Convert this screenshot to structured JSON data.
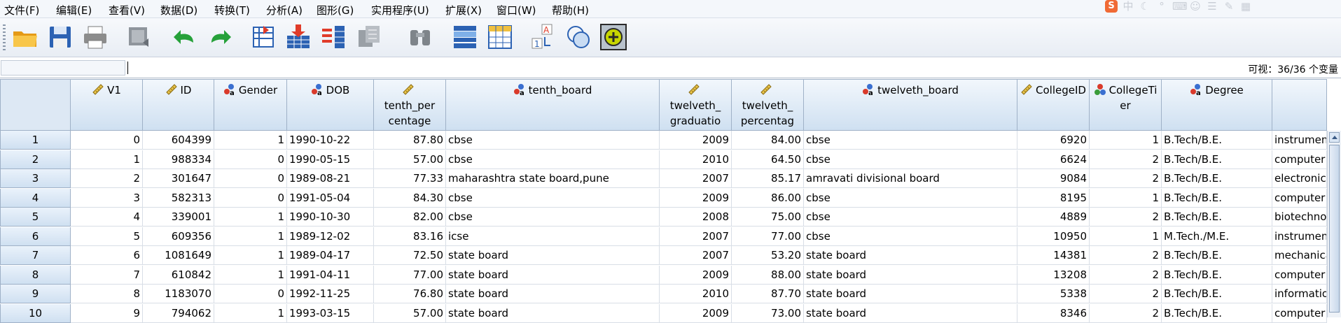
{
  "menu": [
    "文件(F)",
    "编辑(E)",
    "查看(V)",
    "数据(D)",
    "转换(T)",
    "分析(A)",
    "图形(G)",
    "实用程序(U)",
    "扩展(X)",
    "窗口(W)",
    "帮助(H)"
  ],
  "tray_icons": [
    "sogou-s-icon",
    "chinese-input-icon",
    "moon-icon",
    "punctuation-icon",
    "keyboard-icon",
    "user-icon",
    "menu-icon",
    "skin-icon",
    "grid-icon"
  ],
  "toolbar": [
    {
      "name": "open-folder-icon"
    },
    {
      "name": "save-icon"
    },
    {
      "name": "print-icon"
    },
    {
      "name": "dialog-recall-icon"
    },
    {
      "name": "undo-icon"
    },
    {
      "name": "redo-icon"
    },
    {
      "name": "goto-case-icon"
    },
    {
      "name": "goto-variable-icon"
    },
    {
      "name": "variables-icon"
    },
    {
      "name": "run-descriptives-icon"
    },
    {
      "name": "find-icon"
    },
    {
      "name": "insert-cases-icon"
    },
    {
      "name": "insert-variable-icon"
    },
    {
      "name": "split-file-icon"
    },
    {
      "name": "weight-cases-icon"
    },
    {
      "name": "select-cases-icon"
    },
    {
      "name": "value-labels-icon"
    },
    {
      "name": "use-variable-sets-icon"
    }
  ],
  "editbar": {
    "cell_name": "",
    "cell_value": "",
    "visible_count": "可视：36/36 个变量"
  },
  "columns": [
    {
      "name": "V1",
      "type": "scale",
      "align": "right"
    },
    {
      "name": "ID",
      "type": "scale",
      "align": "right"
    },
    {
      "name": "Gender",
      "type": "nominal",
      "align": "right"
    },
    {
      "name": "DOB",
      "type": "nominal",
      "align": "left"
    },
    {
      "name": "tenth_per\ncentage",
      "type": "scale",
      "align": "right"
    },
    {
      "name": "tenth_board",
      "type": "nominal",
      "align": "left"
    },
    {
      "name": "twelveth_\ngraduatio\nn",
      "type": "scale",
      "align": "right"
    },
    {
      "name": "twelveth_\npercentag\ne",
      "type": "scale",
      "align": "right"
    },
    {
      "name": "twelveth_board",
      "type": "nominal",
      "align": "left"
    },
    {
      "name": "CollegeID",
      "type": "scale",
      "align": "right"
    },
    {
      "name": "CollegeTi\ner",
      "type": "nominal-balls",
      "align": "right"
    },
    {
      "name": "Degree",
      "type": "nominal",
      "align": "left"
    },
    {
      "name": "",
      "type": "none",
      "align": "left"
    }
  ],
  "row_numbers": [
    "1",
    "2",
    "3",
    "4",
    "5",
    "6",
    "7",
    "8",
    "9",
    "10"
  ],
  "rows": [
    [
      "0",
      "604399",
      "1",
      "1990-10-22",
      "87.80",
      "cbse",
      "2009",
      "84.00",
      "cbse",
      "6920",
      "1",
      "B.Tech/B.E.",
      "instrument"
    ],
    [
      "1",
      "988334",
      "0",
      "1990-05-15",
      "57.00",
      "cbse",
      "2010",
      "64.50",
      "cbse",
      "6624",
      "2",
      "B.Tech/B.E.",
      "computer s"
    ],
    [
      "2",
      "301647",
      "0",
      "1989-08-21",
      "77.33",
      "maharashtra state board,pune",
      "2007",
      "85.17",
      "amravati divisional board",
      "9084",
      "2",
      "B.Tech/B.E.",
      "electronics"
    ],
    [
      "3",
      "582313",
      "0",
      "1991-05-04",
      "84.30",
      "cbse",
      "2009",
      "86.00",
      "cbse",
      "8195",
      "1",
      "B.Tech/B.E.",
      "computer s"
    ],
    [
      "4",
      "339001",
      "1",
      "1990-10-30",
      "82.00",
      "cbse",
      "2008",
      "75.00",
      "cbse",
      "4889",
      "2",
      "B.Tech/B.E.",
      "biotechnol"
    ],
    [
      "5",
      "609356",
      "1",
      "1989-12-02",
      "83.16",
      "icse",
      "2007",
      "77.00",
      "cbse",
      "10950",
      "1",
      "M.Tech./M.E.",
      "instrument"
    ],
    [
      "6",
      "1081649",
      "1",
      "1989-04-17",
      "72.50",
      "state board",
      "2007",
      "53.20",
      "state board",
      "14381",
      "2",
      "B.Tech/B.E.",
      "mechanica"
    ],
    [
      "7",
      "610842",
      "1",
      "1991-04-11",
      "77.00",
      "state board",
      "2009",
      "88.00",
      "state board",
      "13208",
      "2",
      "B.Tech/B.E.",
      "computer s"
    ],
    [
      "8",
      "1183070",
      "0",
      "1992-11-25",
      "76.80",
      "state board",
      "2010",
      "87.70",
      "state board",
      "5338",
      "2",
      "B.Tech/B.E.",
      "information"
    ],
    [
      "9",
      "794062",
      "1",
      "1993-03-15",
      "57.00",
      "state board",
      "2009",
      "73.00",
      "state board",
      "8346",
      "2",
      "B.Tech/B.E.",
      "computer s"
    ]
  ]
}
